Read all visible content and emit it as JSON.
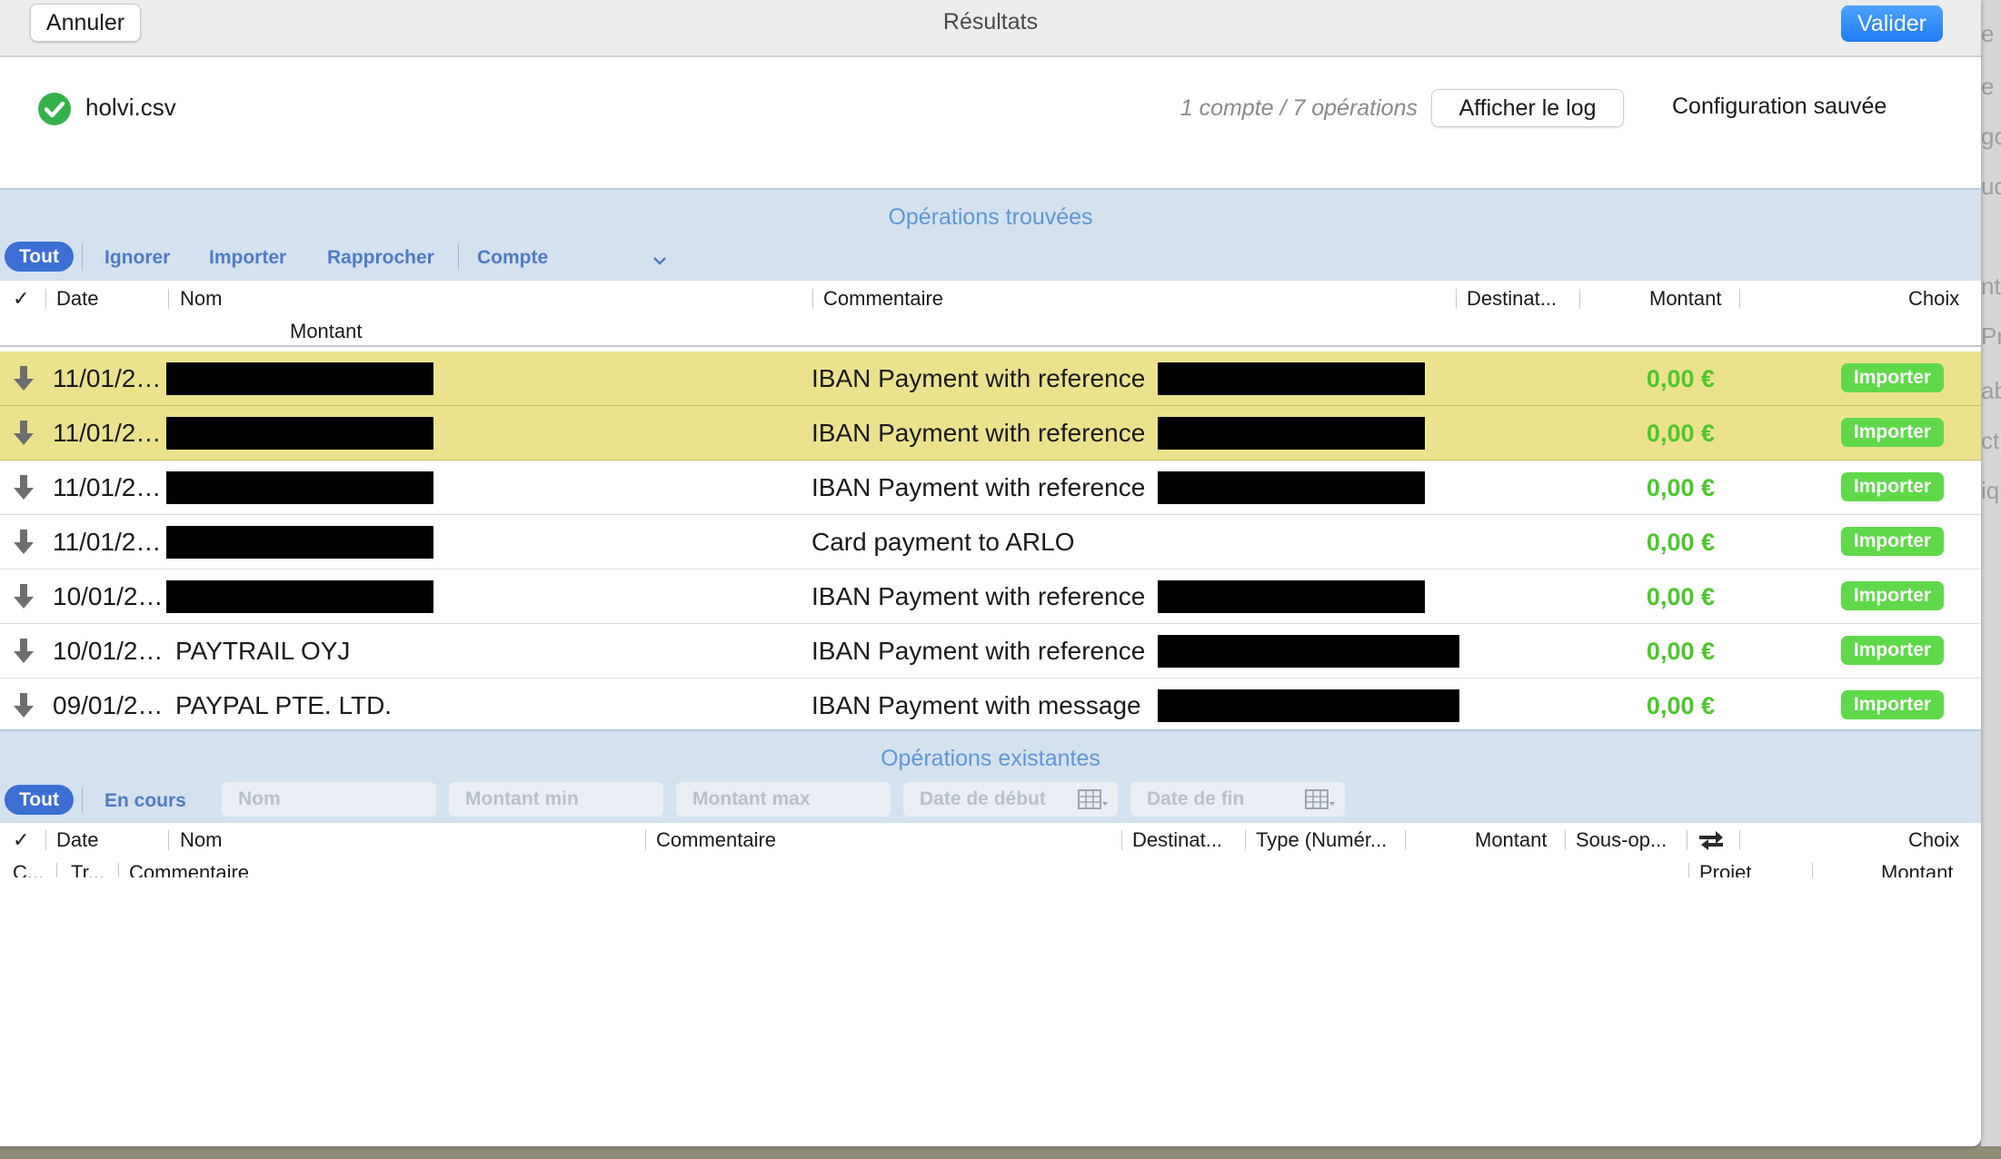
{
  "window": {
    "title": "Résultats",
    "cancel_label": "Annuler",
    "validate_label": "Valider"
  },
  "file": {
    "name": "holvi.csv",
    "summary": "1 compte / 7 opérations",
    "log_label": "Afficher le log",
    "config_status": "Configuration sauvée"
  },
  "found": {
    "title": "Opérations trouvées",
    "filters": {
      "all": "Tout",
      "ignore": "Ignorer",
      "import": "Importer",
      "reconcile": "Rapprocher",
      "account": "Compte"
    },
    "columns": {
      "check": "✓",
      "date": "Date",
      "name": "Nom",
      "comment": "Commentaire",
      "destination": "Destinat...",
      "amount": "Montant",
      "choice": "Choix",
      "amount2": "Montant"
    },
    "rows": [
      {
        "date": "11/01/2…",
        "name": "",
        "name_redacted": true,
        "comment": "IBAN Payment with reference",
        "comment_redacted": true,
        "amount": "0,00 €",
        "choice": "Importer",
        "highlighted": true
      },
      {
        "date": "11/01/2…",
        "name": "",
        "name_redacted": true,
        "comment": "IBAN Payment with reference",
        "comment_redacted": true,
        "amount": "0,00 €",
        "choice": "Importer",
        "highlighted": true
      },
      {
        "date": "11/01/2…",
        "name": "",
        "name_redacted": true,
        "comment": "IBAN Payment with reference",
        "comment_redacted": true,
        "amount": "0,00 €",
        "choice": "Importer",
        "highlighted": false
      },
      {
        "date": "11/01/2…",
        "name": "",
        "name_redacted": true,
        "comment": "Card payment to ARLO",
        "comment_redacted": false,
        "amount": "0,00 €",
        "choice": "Importer",
        "highlighted": false
      },
      {
        "date": "10/01/2…",
        "name": "",
        "name_redacted": true,
        "comment": "IBAN Payment with reference",
        "comment_redacted": true,
        "amount": "0,00 €",
        "choice": "Importer",
        "highlighted": false
      },
      {
        "date": "10/01/2…",
        "name": "PAYTRAIL OYJ",
        "name_redacted": false,
        "comment": "IBAN Payment with reference",
        "comment_redacted": true,
        "amount": "0,00 €",
        "choice": "Importer",
        "highlighted": false
      },
      {
        "date": "09/01/2…",
        "name": "PAYPAL PTE. LTD.",
        "name_redacted": false,
        "comment": "IBAN Payment with message",
        "comment_redacted": true,
        "amount": "0,00 €",
        "choice": "Importer",
        "highlighted": false
      }
    ]
  },
  "existing": {
    "title": "Opérations existantes",
    "filters": {
      "all": "Tout",
      "pending": "En cours",
      "name_placeholder": "Nom",
      "min_placeholder": "Montant min",
      "max_placeholder": "Montant max",
      "start_placeholder": "Date de début",
      "end_placeholder": "Date de fin"
    },
    "columns": {
      "check": "✓",
      "date": "Date",
      "name": "Nom",
      "comment": "Commentaire",
      "destination": "Destinat...",
      "type": "Type (Numér...",
      "amount": "Montant",
      "subop": "Sous-op...",
      "choice": "Choix",
      "c": "C...",
      "tr": "Tr...",
      "comment2": "Commentaire",
      "project": "Projet",
      "amount2": "Montant"
    }
  },
  "colors": {
    "accent": "#3b6fd4",
    "highlight_row": "#ece28e",
    "amount_green": "#4cc72c",
    "import_badge": "#5fd94a",
    "section_band": "#d4e1ef"
  }
}
